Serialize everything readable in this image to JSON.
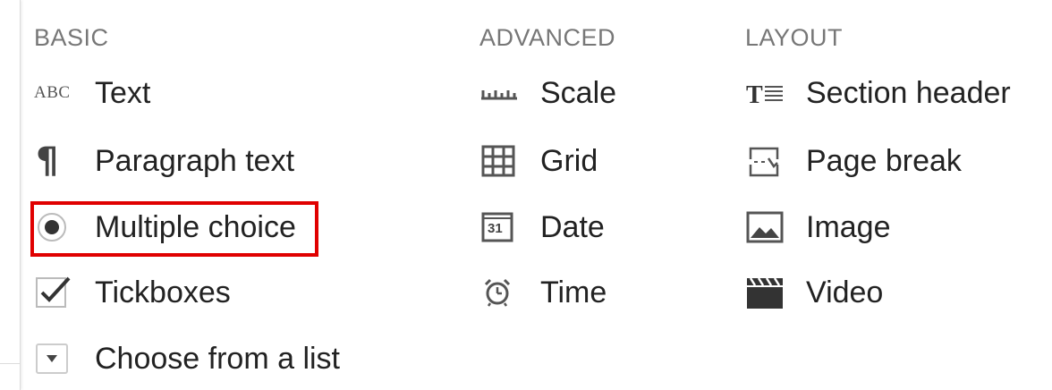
{
  "columns": {
    "basic": {
      "heading": "BASIC",
      "items": [
        {
          "label": "Text",
          "icon": "abc-text-icon"
        },
        {
          "label": "Paragraph text",
          "icon": "pilcrow-icon"
        },
        {
          "label": "Multiple choice",
          "icon": "radio-button-icon",
          "highlighted": true
        },
        {
          "label": "Tickboxes",
          "icon": "checkbox-icon"
        },
        {
          "label": "Choose from a list",
          "icon": "dropdown-icon"
        }
      ]
    },
    "advanced": {
      "heading": "ADVANCED",
      "items": [
        {
          "label": "Scale",
          "icon": "scale-icon"
        },
        {
          "label": "Grid",
          "icon": "grid-icon"
        },
        {
          "label": "Date",
          "icon": "calendar-icon",
          "icon_text": "31"
        },
        {
          "label": "Time",
          "icon": "alarm-clock-icon"
        }
      ]
    },
    "layout": {
      "heading": "LAYOUT",
      "items": [
        {
          "label": "Section header",
          "icon": "section-header-icon"
        },
        {
          "label": "Page break",
          "icon": "page-break-icon"
        },
        {
          "label": "Image",
          "icon": "image-icon"
        },
        {
          "label": "Video",
          "icon": "video-clapper-icon"
        }
      ]
    }
  },
  "icon_glyphs": {
    "abc_text": "ABC",
    "pilcrow": "¶"
  },
  "colors": {
    "highlight_border": "#e00000",
    "heading_text": "#777777",
    "item_text": "#222222",
    "icon": "#555555"
  }
}
